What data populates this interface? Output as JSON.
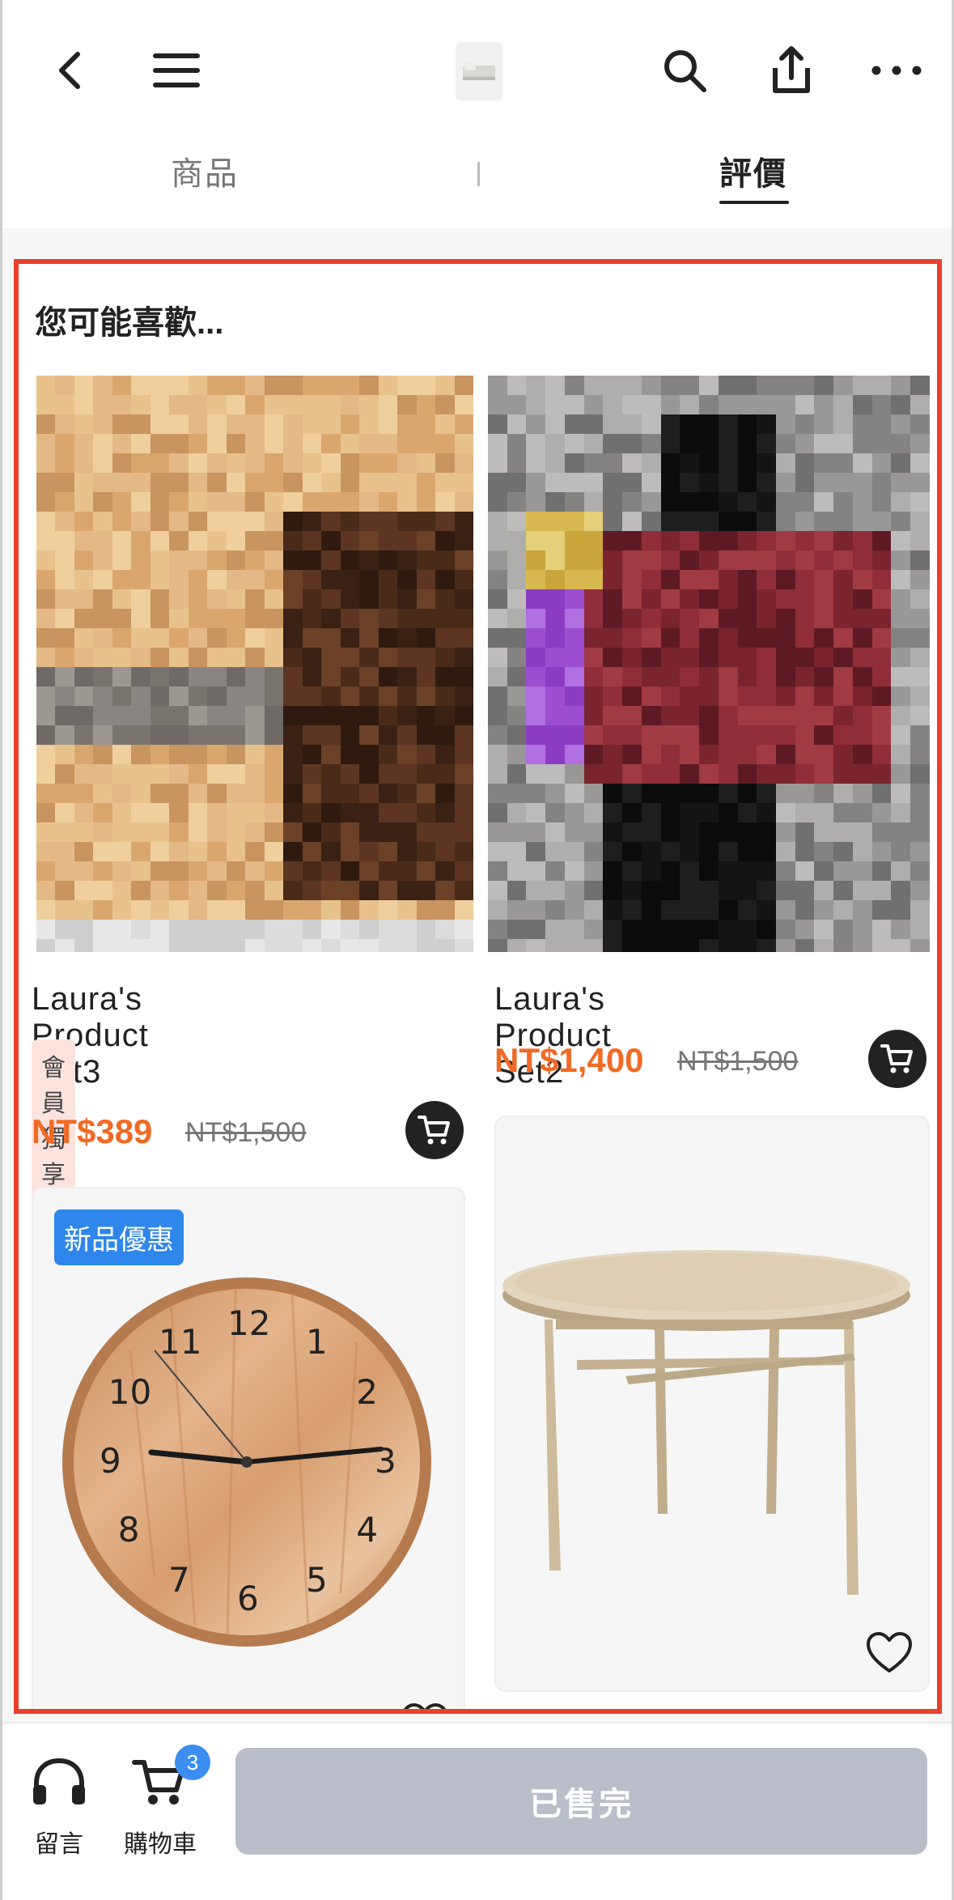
{
  "header": {
    "back_icon": "chevron-left-icon",
    "menu_icon": "hamburger-icon",
    "logo_icon": "bed-thumbnail",
    "search_icon": "search-icon",
    "share_icon": "share-icon",
    "more_icon": "more-icon"
  },
  "tabs": [
    {
      "label": "商品",
      "active": false
    },
    {
      "label": "評價",
      "active": true
    }
  ],
  "recommend": {
    "title": "您可能喜歡...",
    "accent_color": "#e8412e",
    "products": [
      {
        "name": "Laura's Product Set3",
        "badge": "會員獨享",
        "price": "NT$389",
        "original_price": "NT$1,500",
        "image": "pixelated-teddy-bears"
      },
      {
        "name": "Laura's Product Set2",
        "price": "NT$1,400",
        "original_price": "NT$1,500",
        "image": "pixelated-person-red-jacket"
      },
      {
        "badge": "新品優惠",
        "image": "wooden-wall-clock",
        "clock_numbers": [
          "12",
          "1",
          "2",
          "3",
          "4",
          "5",
          "6",
          "7",
          "8",
          "9",
          "10",
          "11"
        ]
      },
      {
        "image": "round-wooden-table"
      }
    ]
  },
  "bottom_bar": {
    "chat_label": "留言",
    "cart_label": "購物車",
    "cart_count": "3",
    "soldout_label": "已售完"
  },
  "colors": {
    "price": "#f06a24",
    "badge_blue": "#2f86eb",
    "member_badge_bg": "#fde3dd",
    "soldout_bg": "#b9bec9"
  }
}
